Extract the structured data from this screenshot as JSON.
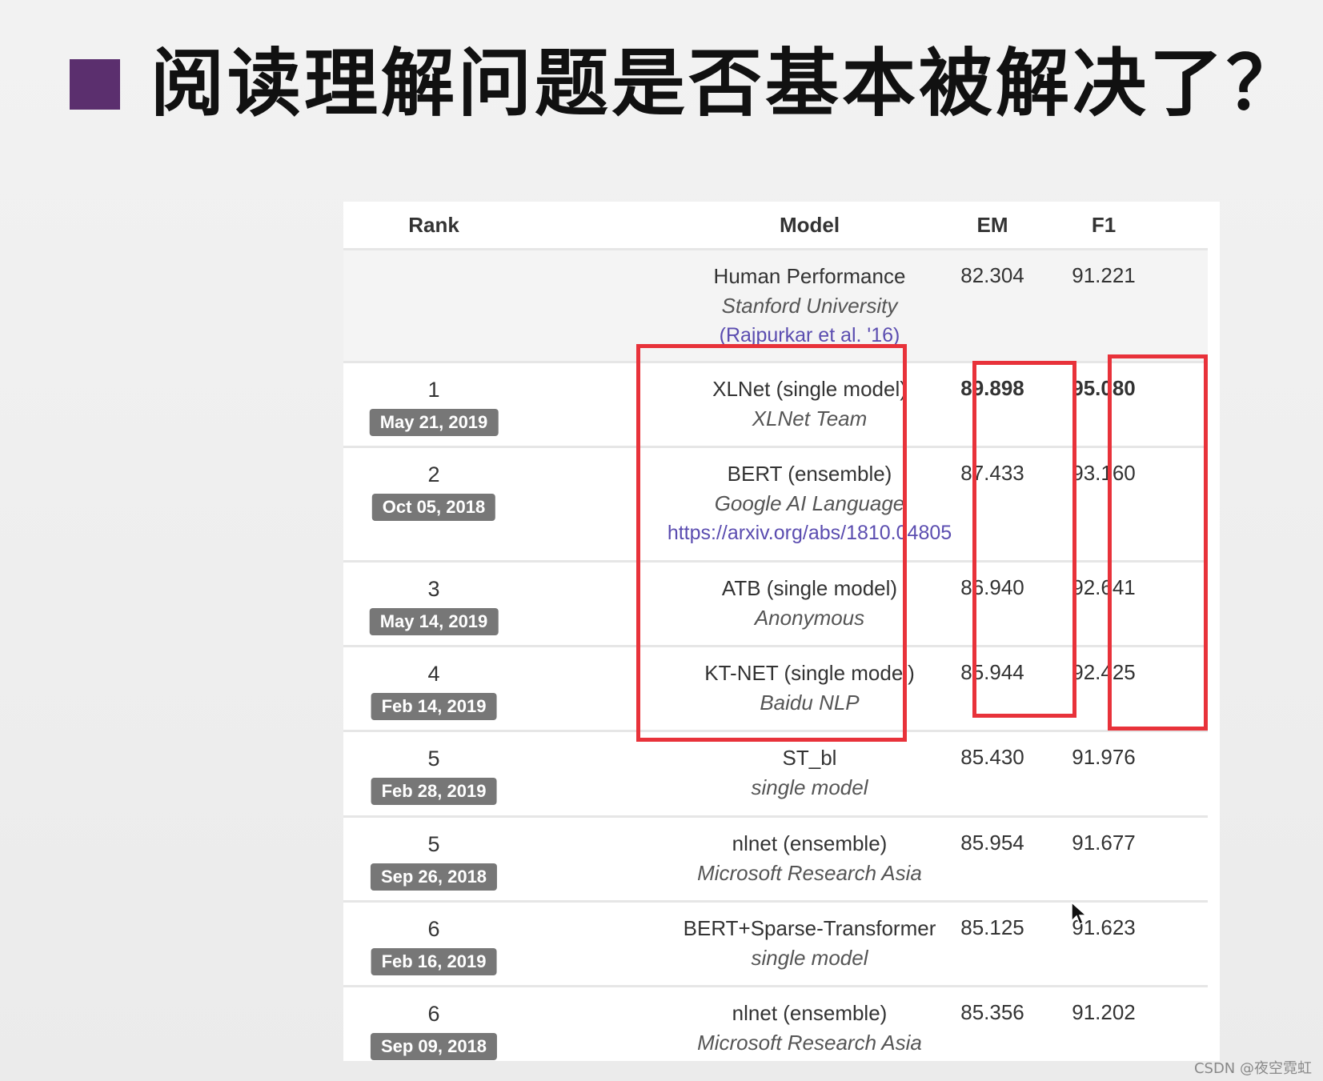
{
  "slide": {
    "title": "阅读理解问题是否基本被解决了？"
  },
  "table": {
    "headers": {
      "rank": "Rank",
      "model": "Model",
      "em": "EM",
      "f1": "F1"
    },
    "human": {
      "model": "Human Performance",
      "org": "Stanford University",
      "link": "(Rajpurkar et al. '16)",
      "em": "82.304",
      "f1": "91.221"
    },
    "rows": [
      {
        "rank": "1",
        "date": "May 21, 2019",
        "model": "XLNet (single model)",
        "org": "XLNet Team",
        "link": "",
        "em": "89.898",
        "f1": "95.080"
      },
      {
        "rank": "2",
        "date": "Oct 05, 2018",
        "model": "BERT (ensemble)",
        "org": "Google AI Language",
        "link": "https://arxiv.org/abs/1810.04805",
        "em": "87.433",
        "f1": "93.160"
      },
      {
        "rank": "3",
        "date": "May 14, 2019",
        "model": "ATB (single model)",
        "org": "Anonymous",
        "link": "",
        "em": "86.940",
        "f1": "92.641"
      },
      {
        "rank": "4",
        "date": "Feb 14, 2019",
        "model": "KT-NET (single model)",
        "org": "Baidu NLP",
        "link": "",
        "em": "85.944",
        "f1": "92.425"
      },
      {
        "rank": "5",
        "date": "Feb 28, 2019",
        "model": "ST_bl",
        "org": "single model",
        "link": "",
        "em": "85.430",
        "f1": "91.976"
      },
      {
        "rank": "5",
        "date": "Sep 26, 2018",
        "model": "nlnet (ensemble)",
        "org": "Microsoft Research Asia",
        "link": "",
        "em": "85.954",
        "f1": "91.677"
      },
      {
        "rank": "6",
        "date": "Feb 16, 2019",
        "model": "BERT+Sparse-Transformer",
        "org": "single model",
        "link": "",
        "em": "85.125",
        "f1": "91.623"
      },
      {
        "rank": "6",
        "date": "Sep 09, 2018",
        "model": "nlnet (ensemble)",
        "org": "Microsoft Research Asia",
        "link": "",
        "em": "85.356",
        "f1": "91.202"
      }
    ]
  },
  "highlight_color": "#e8323a",
  "watermark": "CSDN @夜空霓虹"
}
